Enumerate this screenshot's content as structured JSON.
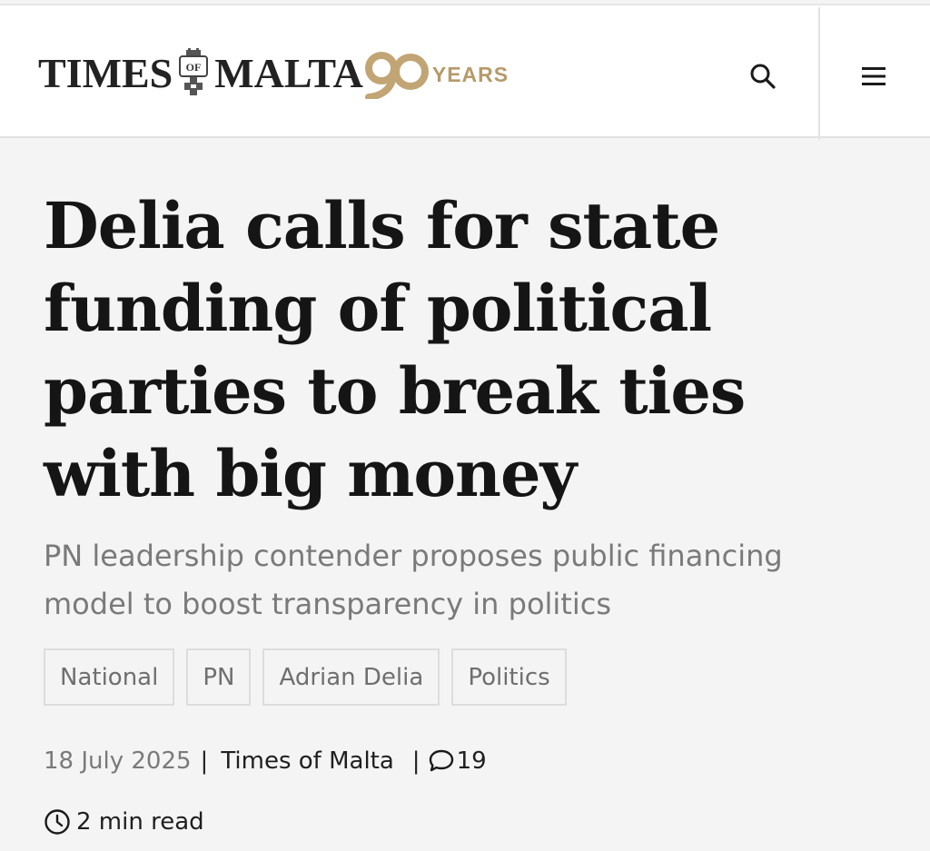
{
  "header": {
    "brand_left": "TIMES",
    "brand_right": "MALTA",
    "crest_text": "OF",
    "anniversary_years": "YEARS",
    "accent_color": "#b69a6a",
    "search_icon": "search-icon",
    "menu_icon": "hamburger-menu-icon"
  },
  "article": {
    "headline": "Delia calls for state funding of political parties to break ties with big money",
    "subheadline": "PN leadership contender proposes public financing model to boost transparency in politics",
    "tags": [
      "National",
      "PN",
      "Adrian Delia",
      "Politics"
    ],
    "date": "18 July 2025",
    "author": "Times of Malta",
    "comment_count": "19",
    "read_time": "2 min read"
  }
}
